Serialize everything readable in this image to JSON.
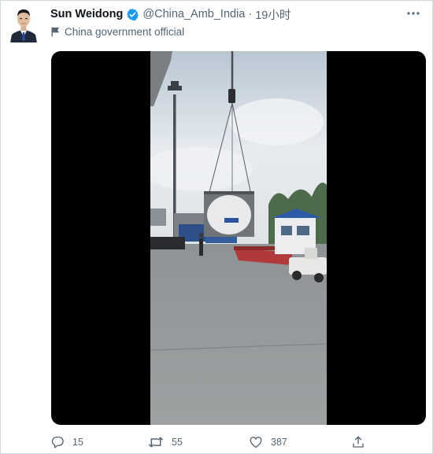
{
  "tweet": {
    "author_name": "Sun Weidong",
    "handle": "@China_Amb_India",
    "separator": "·",
    "time": "19小时",
    "label": "China government official",
    "verified": true,
    "accent_color": "#1d9bf0"
  },
  "media": {
    "type": "video",
    "description_icon": "video-frame"
  },
  "actions": {
    "reply_count": "15",
    "retweet_count": "55",
    "like_count": "387",
    "share_icon": "share-icon"
  },
  "icons": {
    "more": "more-icon",
    "verified": "verified-badge-icon",
    "flag": "flag-icon",
    "reply": "reply-icon",
    "retweet": "retweet-icon",
    "like": "like-icon"
  }
}
